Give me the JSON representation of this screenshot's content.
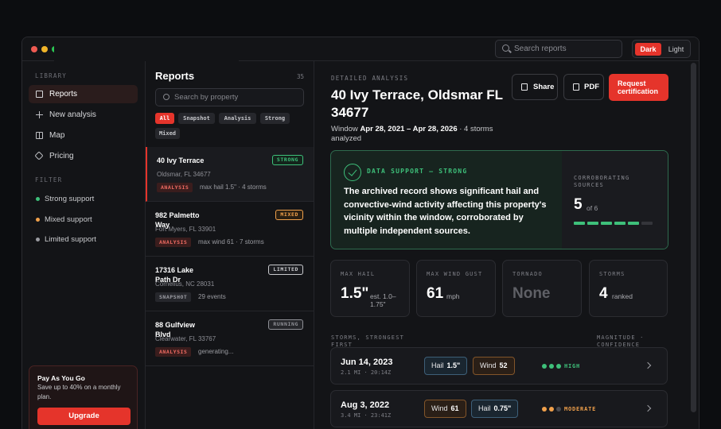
{
  "topbar": {
    "search_placeholder": "Search reports",
    "theme": {
      "dark": "Dark",
      "light": "Light",
      "selected": "Dark"
    }
  },
  "sidebar": {
    "library_label": "LIBRARY",
    "nav": [
      {
        "label": "Reports",
        "icon": "document-icon",
        "active": true
      },
      {
        "label": "New analysis",
        "icon": "plus-icon",
        "active": false
      },
      {
        "label": "Map",
        "icon": "map-icon",
        "active": false
      },
      {
        "label": "Pricing",
        "icon": "tag-icon",
        "active": false
      }
    ],
    "filter_label": "FILTER",
    "filters": [
      {
        "label": "Strong support",
        "color": "#3ec07a"
      },
      {
        "label": "Mixed support",
        "color": "#f0a04b"
      },
      {
        "label": "Limited support",
        "color": "#9a9ba1"
      }
    ],
    "promo": {
      "title": "Pay As You Go",
      "desc": "Save up to 40% on a monthly plan.",
      "button": "Upgrade"
    }
  },
  "reports": {
    "title": "Reports",
    "count": "35",
    "search_placeholder": "Search by property",
    "chips": [
      "All",
      "Snapshot",
      "Analysis",
      "Strong",
      "Mixed"
    ],
    "items": [
      {
        "name": "40 Ivy Terrace",
        "addr": "Oldsmar, FL 34677",
        "status": "STRONG",
        "tag": "ANALYSIS",
        "meta": "max hail 1.5\" · 4 storms"
      },
      {
        "name": "982 Palmetto Way",
        "addr": "Fort Myers, FL 33901",
        "status": "MIXED",
        "tag": "ANALYSIS",
        "meta": "max wind 61 · 7 storms"
      },
      {
        "name": "17316 Lake Path Dr",
        "addr": "Cornelius, NC 28031",
        "status": "LIMITED",
        "tag": "SNAPSHOT",
        "meta": "29 events"
      },
      {
        "name": "88 Gulfview Blvd",
        "addr": "Clearwater, FL 33767",
        "status": "RUNNING",
        "tag": "ANALYSIS",
        "meta": "generating..."
      }
    ]
  },
  "detail": {
    "eyebrow": "DETAILED ANALYSIS",
    "title": "40 Ivy Terrace, Oldsmar FL 34677",
    "window_prefix": "Window ",
    "window_range": "Apr 28, 2021 – Apr 28, 2026",
    "window_suffix": " · 4 storms analyzed",
    "actions": {
      "share": "Share",
      "pdf": "PDF",
      "request": "Request certification"
    },
    "support": {
      "heading": "DATA SUPPORT — STRONG",
      "body": "The archived record shows significant hail and convective-wind activity affecting this property's vicinity within the window, corroborated by multiple independent sources.",
      "corro_label": "CORROBORATING SOURCES",
      "corro_value": "5",
      "corro_of": "of 6",
      "corro_fraction": 0.8333
    },
    "stats": [
      {
        "label": "MAX HAIL",
        "value": "1.5\"",
        "unit": "est. 1.0–1.75\""
      },
      {
        "label": "MAX WIND GUST",
        "value": "61",
        "unit": "mph"
      },
      {
        "label": "TORNADO",
        "value": "None",
        "unit": ""
      },
      {
        "label": "STORMS",
        "value": "4",
        "unit": "ranked"
      }
    ],
    "storms_label": "STORMS, STRONGEST FIRST",
    "magnitude_label": "MAGNITUDE · CONFIDENCE",
    "storms": [
      {
        "date": "Jun 14, 2023",
        "meta": "2.1 MI · 20:14Z",
        "p1": {
          "k": "Hail",
          "v": "1.5\""
        },
        "p2": {
          "k": "Wind",
          "v": "52"
        },
        "conf": "HIGH",
        "conf_dots": 3,
        "color": "#3ec07a"
      },
      {
        "date": "Aug 3, 2022",
        "meta": "3.4 MI · 23:41Z",
        "p1": {
          "k": "Wind",
          "v": "61"
        },
        "p2": {
          "k": "Hail",
          "v": "0.75\""
        },
        "conf": "MODERATE",
        "conf_dots": 2,
        "color": "#f0a04b"
      }
    ]
  }
}
